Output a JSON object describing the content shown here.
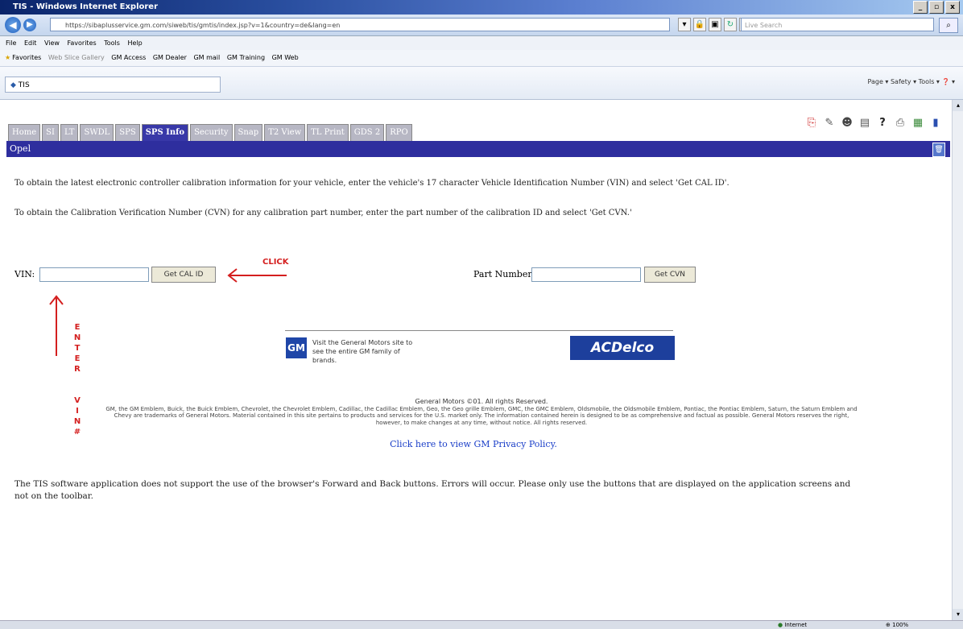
{
  "window": {
    "title": "TIS - Windows Internet Explorer",
    "buttons": [
      "_",
      "▫",
      "x"
    ]
  },
  "addressbar": {
    "url": "https://sibaplusservice.gm.com/siweb/tis/gmtis/index.jsp?v=1&country=de&lang=en",
    "search_placeholder": "Live Search"
  },
  "menu": [
    "File",
    "Edit",
    "View",
    "Favorites",
    "Tools",
    "Help"
  ],
  "favorites": {
    "label": "Favorites",
    "items": [
      "Web Slice Gallery",
      "GM Access",
      "GM Dealer",
      "GM mail",
      "GM Training",
      "GM Web"
    ]
  },
  "command": {
    "page_tab": "TIS",
    "tools": "Page ▾  Safety ▾  Tools ▾  ❓ ▾"
  },
  "app": {
    "tabs": [
      {
        "label": "Home"
      },
      {
        "label": "SI"
      },
      {
        "label": "LT"
      },
      {
        "label": "SWDL"
      },
      {
        "label": "SPS"
      },
      {
        "label": "SPS Info",
        "active": true
      },
      {
        "label": "Security"
      },
      {
        "label": "Snap"
      },
      {
        "label": "T2 View"
      },
      {
        "label": "TL Print"
      },
      {
        "label": "GDS 2"
      },
      {
        "label": "RPO"
      }
    ],
    "header": "Opel",
    "instruction_1": "To obtain the latest electronic controller calibration information for your vehicle, enter the vehicle's 17 character Vehicle Identification Number (VIN) and select 'Get CAL ID'.",
    "instruction_2": "To obtain the Calibration Verification Number (CVN) for any calibration part number, enter the part number of the calibration ID and select 'Get CVN.'",
    "vin_label": "VIN:",
    "vin_value": "",
    "get_cal_id": "Get CAL ID",
    "part_label": "Part Number:",
    "part_value": "",
    "get_cvn": "Get CVN",
    "note": "The TIS software application does not support the use of the browser's Forward and Back buttons. Errors will occur. Please only use the buttons that are displayed on the application screens and not on the toolbar."
  },
  "annotations": {
    "click": "CLICK",
    "enter_vin": [
      "E",
      "N",
      "T",
      "E",
      "R",
      "",
      "V",
      "I",
      "N",
      "#"
    ],
    "color": "#d41f1f"
  },
  "footer": {
    "gm_logo": "GM",
    "gm_text": "Visit the General Motors site to see the entire GM family of brands.",
    "acdelco": "ACDelco",
    "copyright_head": "General Motors ©01. All rights Reserved.",
    "copyright_body": "GM, the GM Emblem, Buick, the Buick Emblem, Chevrolet, the Chevrolet Emblem, Cadillac, the Cadillac Emblem, Geo, the Geo grille Emblem, GMC, the GMC Emblem, Oldsmobile, the Oldsmobile Emblem, Pontiac, the Pontiac Emblem, Saturn, the Saturn Emblem and Chevy are trademarks of General Motors. Material contained in this site pertains to products and services for the U.S. market only. The information contained herein is designed to be as comprehensive and factual as possible. General Motors reserves the right, however, to make changes at any time, without notice. All rights reserved.",
    "privacy": "Click here to view GM Privacy Policy."
  },
  "status": {
    "zone": "Internet",
    "zoom": "100%"
  }
}
